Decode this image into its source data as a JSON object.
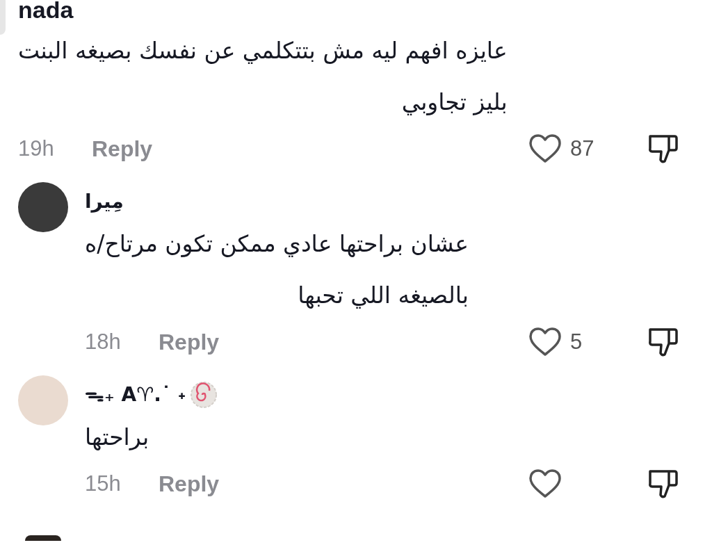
{
  "comments": [
    {
      "username": "nada",
      "text": "عايزه افهم ليه مش بتتكلمي عن نفسك بصيغه البنت\nبليز تجاوبي",
      "time": "19h",
      "reply_label": "Reply",
      "likes": "87",
      "is_reply": false,
      "name_emoji": false
    },
    {
      "username": "مِيرا",
      "text": "عشان براحتها عادي ممكن تكون مرتاح/ه\nبالصيغه اللي تحبها",
      "time": "18h",
      "reply_label": "Reply",
      "likes": "5",
      "is_reply": true,
      "name_emoji": false
    },
    {
      "username": "ᯓ₊ A♈.˙ ˖",
      "text": "براحتها",
      "time": "15h",
      "reply_label": "Reply",
      "is_reply": true,
      "name_emoji": true
    }
  ]
}
